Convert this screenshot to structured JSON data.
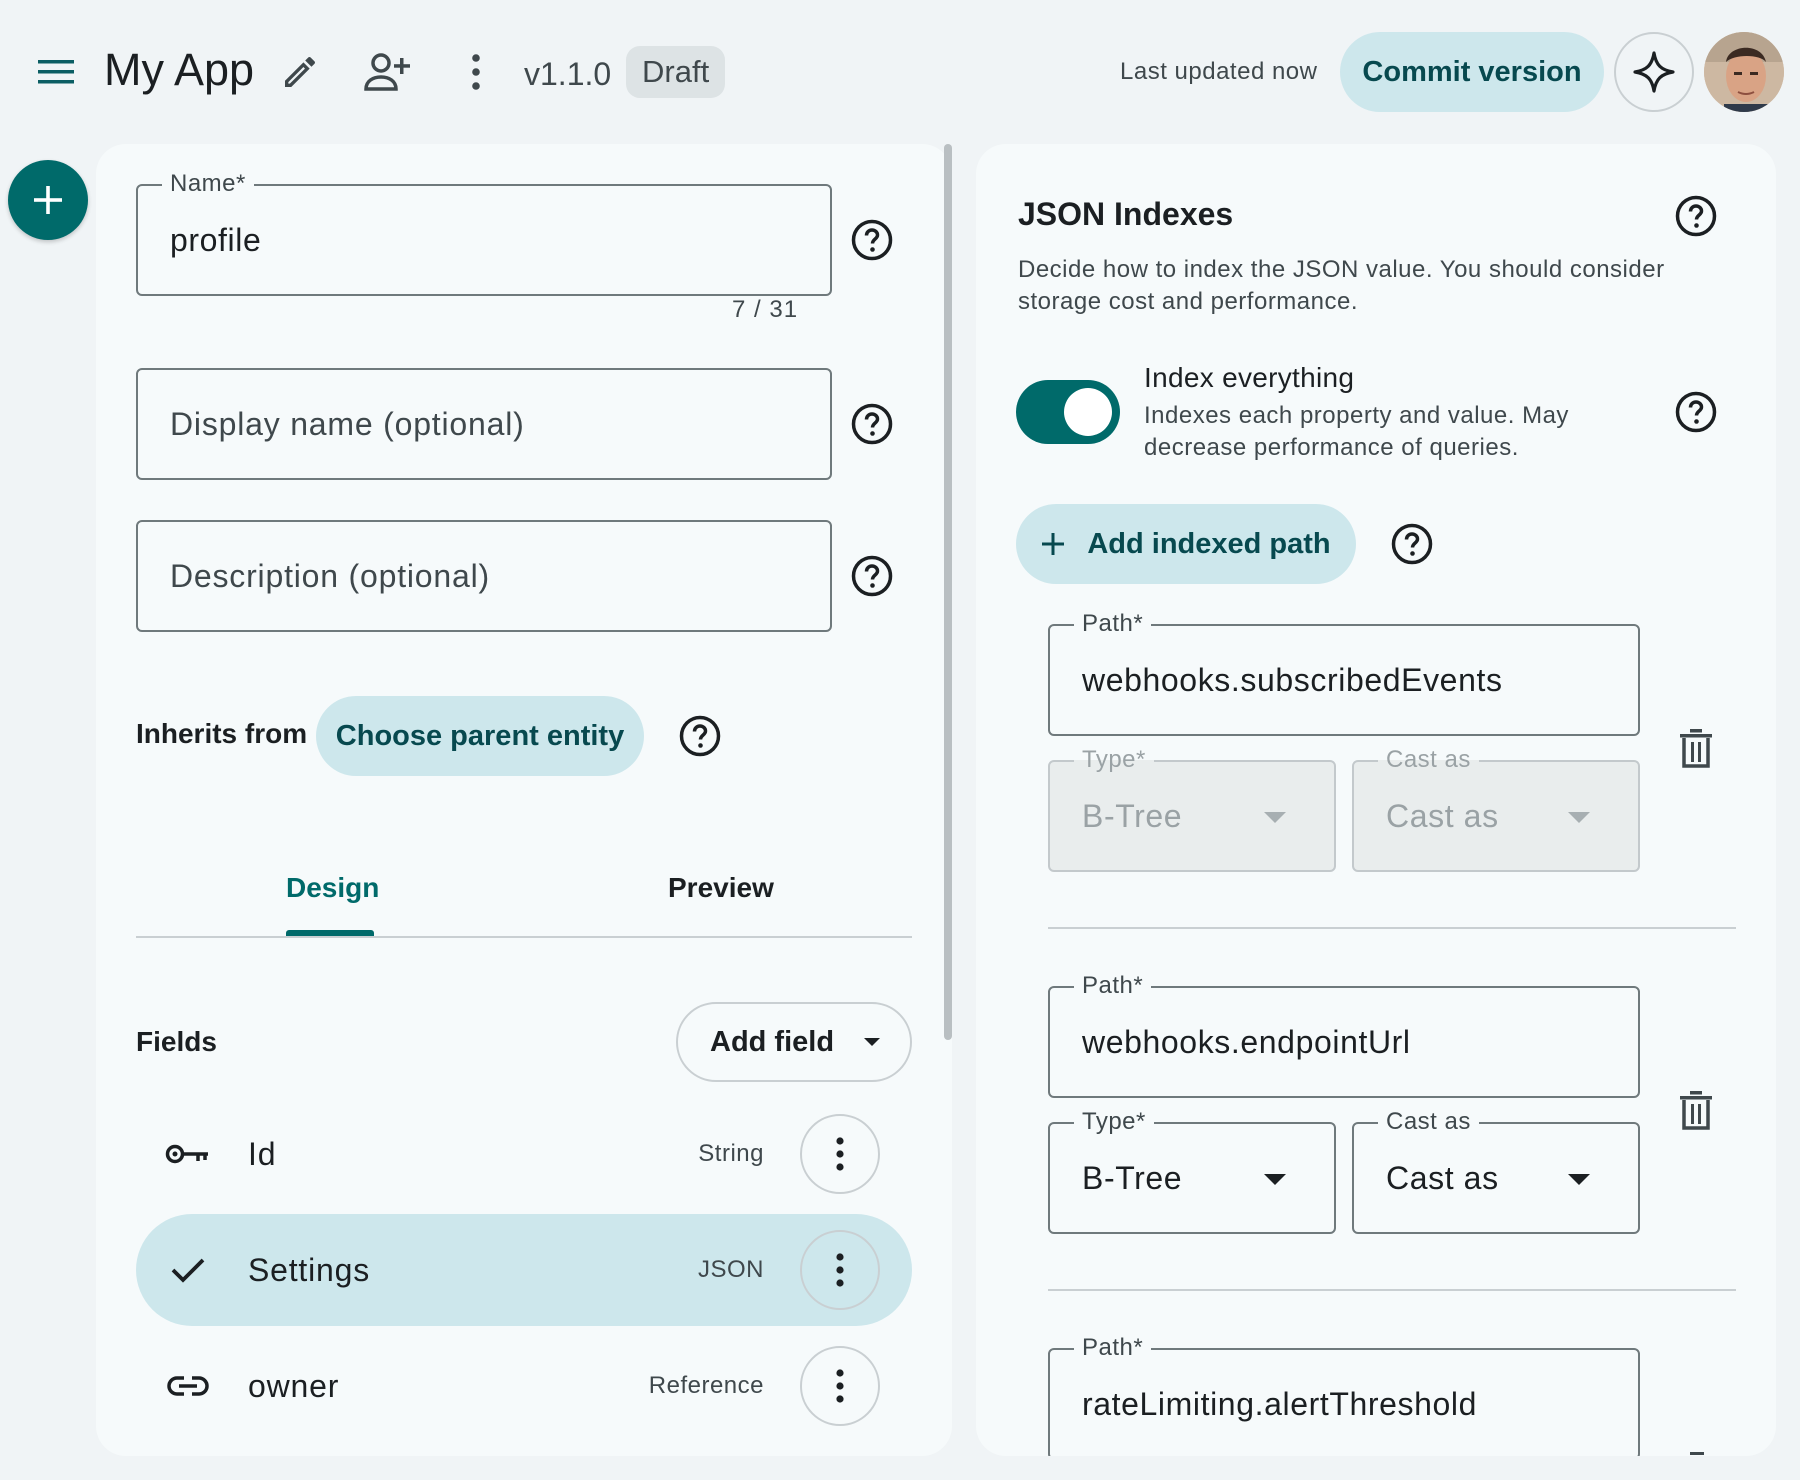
{
  "header": {
    "app_title": "My App",
    "version": "v1.1.0",
    "status_chip": "Draft",
    "last_updated": "Last updated now",
    "commit_label": "Commit version",
    "icons": [
      "menu-icon",
      "edit-icon",
      "add-person-icon",
      "more-vert-icon",
      "sparkle-icon"
    ]
  },
  "form": {
    "name": {
      "label": "Name*",
      "value": "profile",
      "counter": "7 / 31"
    },
    "display_name": {
      "placeholder": "Display name (optional)"
    },
    "description": {
      "placeholder": "Description (optional)"
    },
    "inherits": {
      "label": "Inherits from",
      "button": "Choose parent entity"
    }
  },
  "tabs": [
    {
      "label": "Design",
      "active": true
    },
    {
      "label": "Preview",
      "active": false
    }
  ],
  "fields": {
    "title": "Fields",
    "add_label": "Add field",
    "rows": [
      {
        "name": "Id",
        "type": "String",
        "icon": "key-icon",
        "selected": false
      },
      {
        "name": "Settings",
        "type": "JSON",
        "icon": "check-icon",
        "selected": true
      },
      {
        "name": "owner",
        "type": "Reference",
        "icon": "link-icon",
        "selected": false
      }
    ]
  },
  "json_indexes": {
    "title": "JSON Indexes",
    "description": "Decide how to index the JSON value. You should consider storage cost and performance.",
    "toggle": {
      "title": "Index everything",
      "description": "Indexes each property and value. May decrease performance of queries.",
      "on": true
    },
    "add_path_label": "Add indexed path",
    "paths": [
      {
        "path_label": "Path*",
        "path": "webhooks.subscribedEvents",
        "type_label": "Type*",
        "type": "B-Tree",
        "cast_label": "Cast as",
        "cast": "Cast as",
        "disabled": true
      },
      {
        "path_label": "Path*",
        "path": "webhooks.endpointUrl",
        "type_label": "Type*",
        "type": "B-Tree",
        "cast_label": "Cast as",
        "cast": "Cast as",
        "disabled": false
      },
      {
        "path_label": "Path*",
        "path": "rateLimiting.alertThreshold"
      }
    ]
  },
  "colors": {
    "accent": "#006a6a",
    "tonal": "#cde7ec",
    "tonal_text": "#07494f",
    "background": "#f0f4f6",
    "surface": "#f6fafb"
  }
}
